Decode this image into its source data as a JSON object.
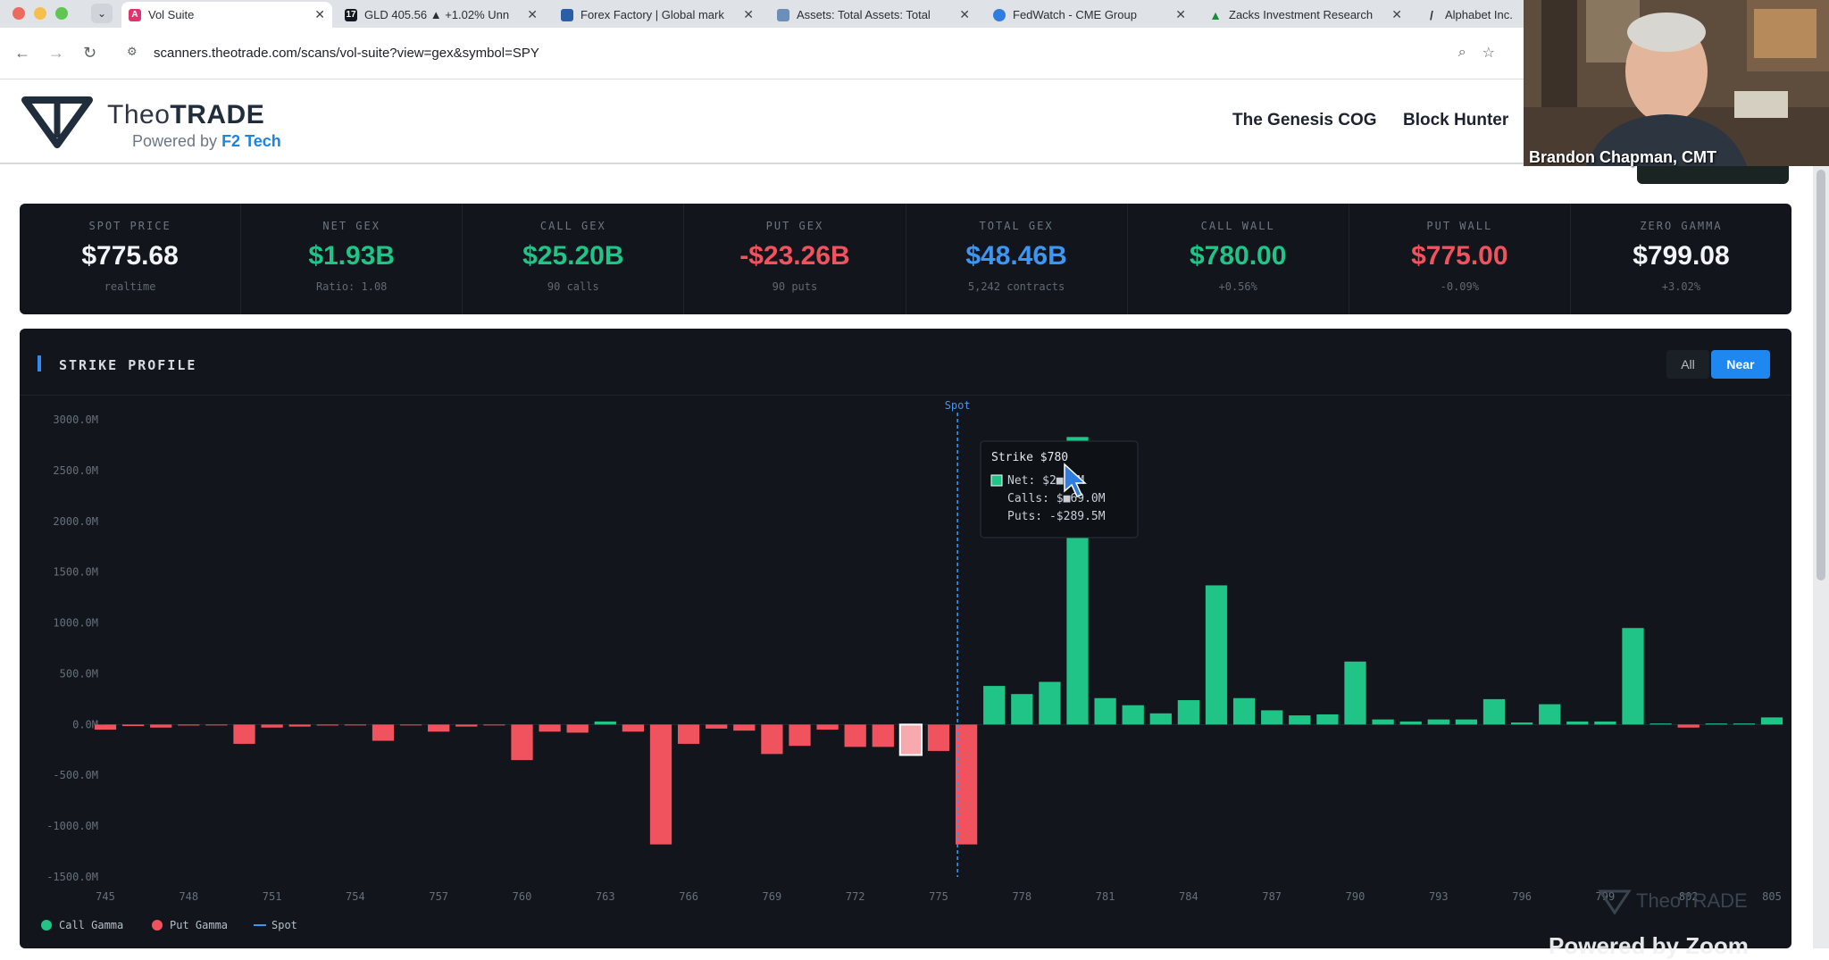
{
  "browser": {
    "tabs": [
      {
        "title": "Vol Suite",
        "active": true,
        "icon": "theotrade-favicon",
        "color": "#e0346e"
      },
      {
        "title": "GLD 405.56 ▲ +1.02% Unn",
        "active": false,
        "icon": "tv-favicon",
        "color": "#131722"
      },
      {
        "title": "Forex Factory | Global mark",
        "active": false,
        "icon": "forexfactory-favicon",
        "color": "#2a5ea8"
      },
      {
        "title": "Assets: Total Assets: Total",
        "active": false,
        "icon": "fred-chart-favicon",
        "color": "#6a8fb8"
      },
      {
        "title": "FedWatch - CME Group",
        "active": false,
        "icon": "globe-favicon",
        "color": "#2f7de1"
      },
      {
        "title": "Zacks Investment Research",
        "active": false,
        "icon": "zacks-favicon",
        "color": "#1a8d3a"
      },
      {
        "title": "Alphabet Inc.",
        "active": false,
        "icon": "seekingalpha-favicon",
        "color": "#333333"
      }
    ],
    "url": "scanners.theotrade.com/scans/vol-suite?view=gex&symbol=SPY"
  },
  "header": {
    "brand_light": "Theo",
    "brand_bold": "TRADE",
    "powered_prefix": "Powered by ",
    "powered_name": "F2 Tech",
    "nav": [
      "The Genesis COG",
      "Block Hunter"
    ]
  },
  "stats": [
    {
      "label": "SPOT PRICE",
      "value": "$775.68",
      "sub": "realtime",
      "color": "#f2f4f7"
    },
    {
      "label": "NET GEX",
      "value": "$1.93B",
      "sub": "Ratio: 1.08",
      "color": "#1fc486"
    },
    {
      "label": "CALL GEX",
      "value": "$25.20B",
      "sub": "90 calls",
      "color": "#1fc486"
    },
    {
      "label": "PUT GEX",
      "value": "-$23.26B",
      "sub": "90 puts",
      "color": "#f0525e"
    },
    {
      "label": "TOTAL GEX",
      "value": "$48.46B",
      "sub": "5,242 contracts",
      "color": "#3b97f3"
    },
    {
      "label": "CALL WALL",
      "value": "$780.00",
      "sub": "+0.56%",
      "color": "#1fc486"
    },
    {
      "label": "PUT WALL",
      "value": "$775.00",
      "sub": "-0.09%",
      "color": "#f0525e"
    },
    {
      "label": "ZERO GAMMA",
      "value": "$799.08",
      "sub": "+3.02%",
      "color": "#f2f4f7"
    }
  ],
  "chart_panel": {
    "title": "STRIKE PROFILE",
    "buttons": {
      "all": "All",
      "near": "Near"
    }
  },
  "chart_data": {
    "type": "bar",
    "title": "STRIKE PROFILE",
    "ylim": [
      -1500,
      3000
    ],
    "yticks": [
      "3000.0M",
      "2500.0M",
      "2000.0M",
      "1500.0M",
      "1000.0M",
      "500.0M",
      "0.0M",
      "-500.0M",
      "-1000.0M",
      "-1500.0M"
    ],
    "ytick_values": [
      3000,
      2500,
      2000,
      1500,
      1000,
      500,
      0,
      -500,
      -1000,
      -1500
    ],
    "xticks": [
      "745",
      "748",
      "751",
      "754",
      "757",
      "760",
      "763",
      "766",
      "769",
      "772",
      "775",
      "778",
      "781",
      "784",
      "787",
      "790",
      "793",
      "796",
      "799",
      "802",
      "805"
    ],
    "x_start": 745,
    "x_end": 805,
    "strikes": [
      745,
      746,
      747,
      748,
      749,
      750,
      751,
      752,
      753,
      754,
      755,
      756,
      757,
      758,
      759,
      760,
      761,
      762,
      763,
      764,
      765,
      766,
      767,
      768,
      769,
      770,
      771,
      772,
      773,
      774,
      775,
      776,
      777,
      778,
      779,
      780,
      781,
      782,
      783,
      784,
      785,
      786,
      787,
      788,
      789,
      790,
      791,
      792,
      793,
      794,
      795,
      796,
      797,
      798,
      799,
      800,
      801,
      802,
      803,
      804,
      805
    ],
    "net_gamma": [
      -50,
      -15,
      -30,
      -10,
      -5,
      -190,
      -30,
      -20,
      -10,
      -5,
      -160,
      -5,
      -70,
      -20,
      -5,
      -350,
      -70,
      -80,
      30,
      -70,
      -1180,
      -190,
      -40,
      -60,
      -290,
      -210,
      -50,
      -220,
      -220,
      -300,
      -260,
      -1180,
      380,
      300,
      420,
      2830,
      260,
      190,
      110,
      240,
      1370,
      260,
      140,
      90,
      100,
      620,
      50,
      30,
      50,
      50,
      250,
      20,
      200,
      30,
      30,
      950,
      10,
      -30,
      10,
      10,
      70
    ],
    "spot": 775.68,
    "spot_label": "Spot",
    "series": [
      {
        "name": "Call Gamma",
        "color": "#1fc486"
      },
      {
        "name": "Put Gamma",
        "color": "#f0525e"
      },
      {
        "name": "Spot",
        "color": "#3b97f3"
      }
    ],
    "tooltip": {
      "title": "Strike $780",
      "lines": [
        "Net: $2■.4M",
        "Calls: $■69.0M",
        "Puts: -$289.5M"
      ]
    },
    "legend_position": "bottom-left",
    "grid": false
  },
  "overlay": {
    "presenter": "Brandon Chapman, CMT",
    "watermark_brand": "TheoTRADE",
    "zoom": "Powered by Zoom"
  }
}
